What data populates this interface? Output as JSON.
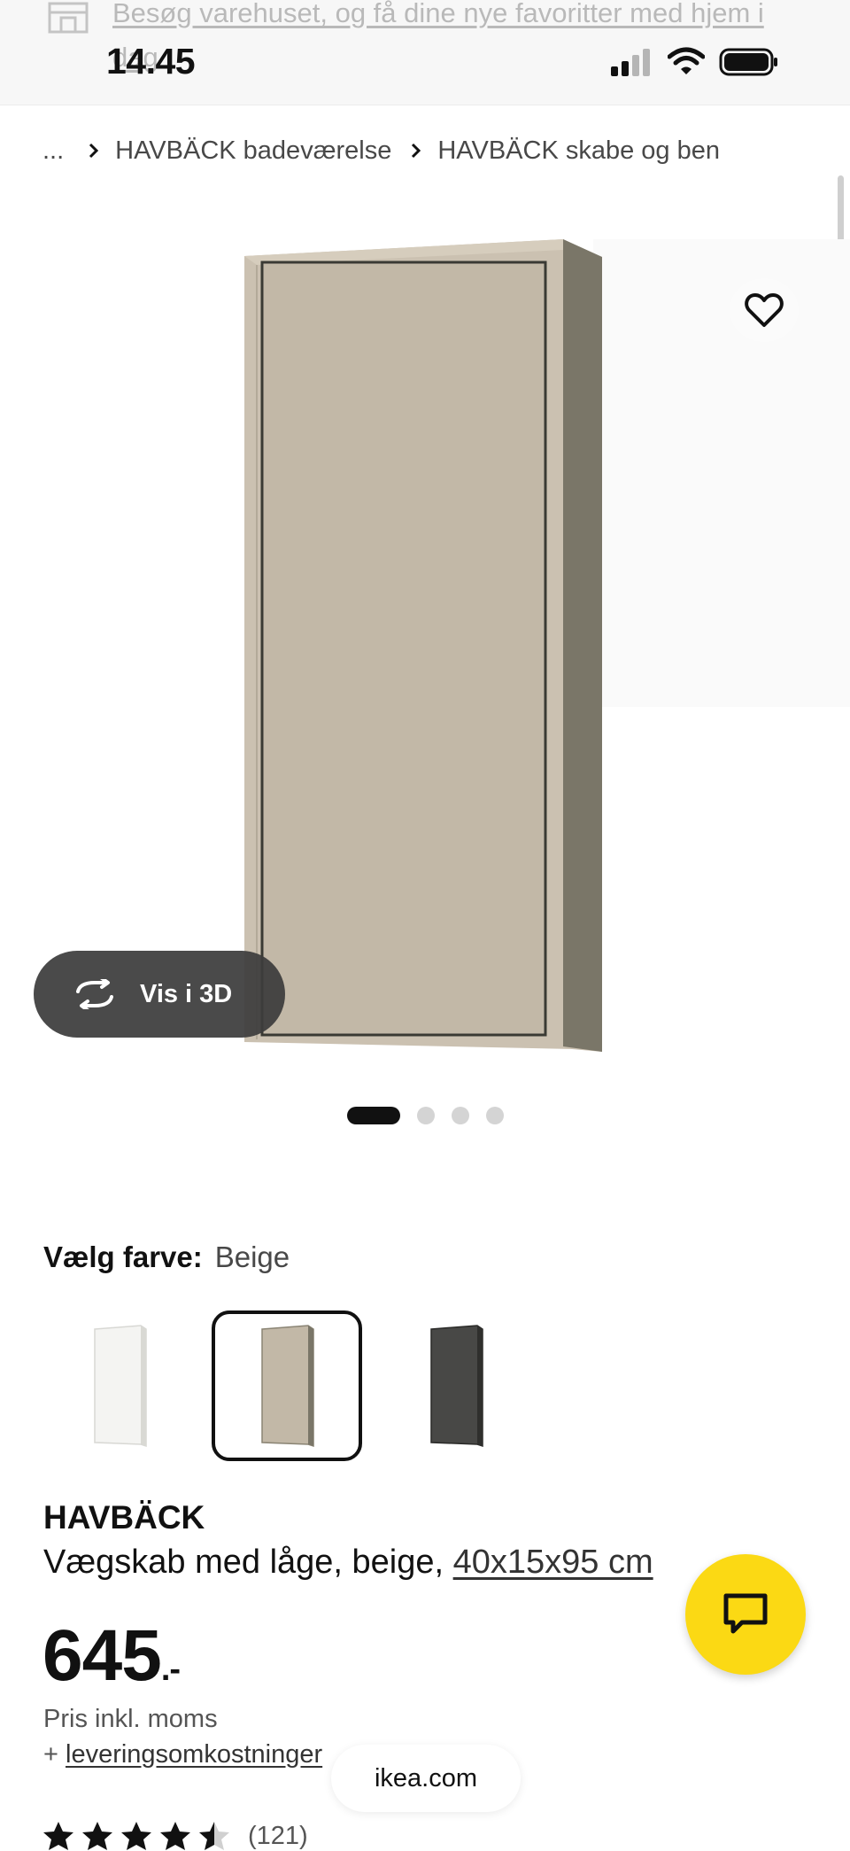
{
  "status_bar": {
    "time": "14.45",
    "banner_text": "Besøg varehuset, og få dine nye favoritter med hjem i dag"
  },
  "breadcrumb": {
    "ellipsis": "...",
    "items": [
      "HAVBÄCK badeværelse",
      "HAVBÄCK skabe og ben"
    ]
  },
  "gallery": {
    "view_3d_label": "Vis i 3D",
    "image_count": 4,
    "active_index": 0
  },
  "color_picker": {
    "label": "Vælg farve:",
    "selected": "Beige",
    "swatches": [
      {
        "name": "white",
        "color": "#f3f3f1"
      },
      {
        "name": "beige",
        "color": "#c2b8a7",
        "selected": true
      },
      {
        "name": "dark-grey",
        "color": "#484846"
      }
    ]
  },
  "product": {
    "name": "HAVBÄCK",
    "description": "Vægskab med låge, beige, ",
    "dimensions": "40x15x95 cm",
    "price": "645",
    "price_suffix": ".-",
    "vat_note": "Pris inkl. moms",
    "delivery_prefix": "+ ",
    "delivery_link": "leveringsomkostninger",
    "rating": 4.5,
    "review_count": "(121)"
  },
  "browser": {
    "url": "ikea.com"
  },
  "colors": {
    "chat_button": "#fbd914",
    "text_primary": "#111111",
    "text_secondary": "#484848"
  },
  "icons": [
    "store-icon",
    "signal-icon",
    "wifi-icon",
    "battery-icon",
    "chevron-right-icon",
    "heart-icon",
    "rotate-3d-icon",
    "chat-icon",
    "star-icon"
  ]
}
